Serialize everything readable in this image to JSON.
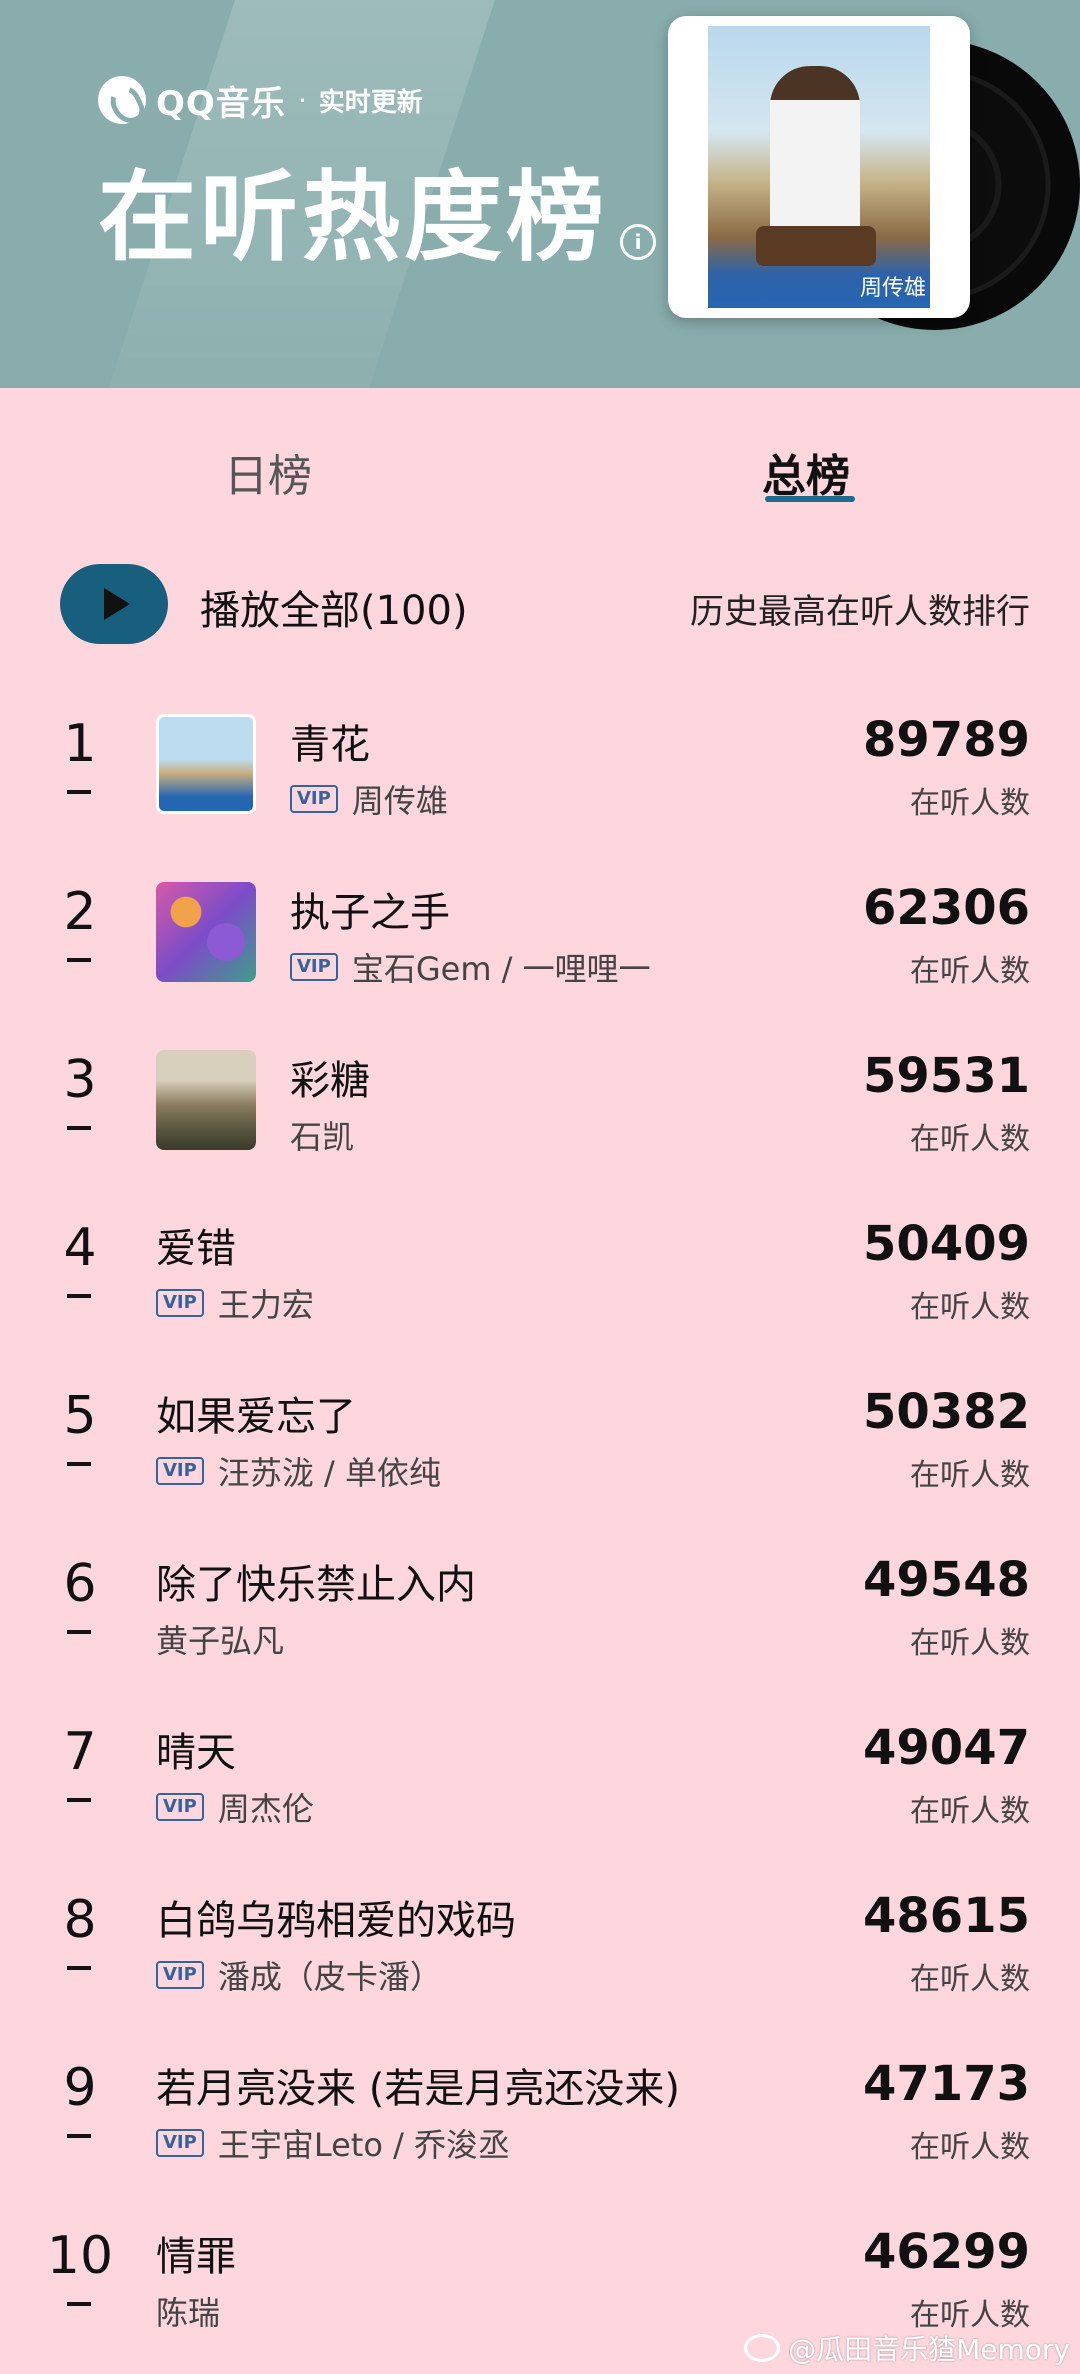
{
  "header": {
    "brand_name": "QQ音乐",
    "brand_separator": "·",
    "brand_tag": "实时更新",
    "title": "在听热度榜",
    "info_icon": "i",
    "cover_text": "周传雄"
  },
  "tabs": [
    {
      "label": "日榜",
      "active": false
    },
    {
      "label": "总榜",
      "active": true
    }
  ],
  "actions": {
    "play_all": "播放全部(100)",
    "sort_label": "历史最高在听人数排行"
  },
  "count_label": "在听人数",
  "songs": [
    {
      "rank": "1",
      "title": "青花",
      "artist": "周传雄",
      "vip": true,
      "count": "89789",
      "has_thumb": true
    },
    {
      "rank": "2",
      "title": "执子之手",
      "artist": "宝石Gem / 一哩哩一",
      "vip": true,
      "count": "62306",
      "has_thumb": true
    },
    {
      "rank": "3",
      "title": "彩糖",
      "artist": "石凯",
      "vip": false,
      "count": "59531",
      "has_thumb": true
    },
    {
      "rank": "4",
      "title": "爱错",
      "artist": "王力宏",
      "vip": true,
      "count": "50409",
      "has_thumb": false
    },
    {
      "rank": "5",
      "title": "如果爱忘了",
      "artist": "汪苏泷 / 单依纯",
      "vip": true,
      "count": "50382",
      "has_thumb": false
    },
    {
      "rank": "6",
      "title": "除了快乐禁止入内",
      "artist": "黄子弘凡",
      "vip": false,
      "count": "49548",
      "has_thumb": false
    },
    {
      "rank": "7",
      "title": "晴天",
      "artist": "周杰伦",
      "vip": true,
      "count": "49047",
      "has_thumb": false
    },
    {
      "rank": "8",
      "title": "白鸽乌鸦相爱的戏码",
      "artist": "潘成（皮卡潘）",
      "vip": true,
      "count": "48615",
      "has_thumb": false
    },
    {
      "rank": "9",
      "title": "若月亮没来 (若是月亮还没来)",
      "artist": "王宇宙Leto / 乔浚丞",
      "vip": true,
      "count": "47173",
      "has_thumb": false
    },
    {
      "rank": "10",
      "title": "情罪",
      "artist": "陈瑞",
      "vip": false,
      "count": "46299",
      "has_thumb": false
    }
  ],
  "vip_label": "VIP",
  "watermark": "@瓜田音乐猹Memory",
  "colors": {
    "header_bg": "#88adac",
    "page_bg": "#fdd7dd",
    "accent": "#185f7d",
    "vip": "#35639a"
  }
}
